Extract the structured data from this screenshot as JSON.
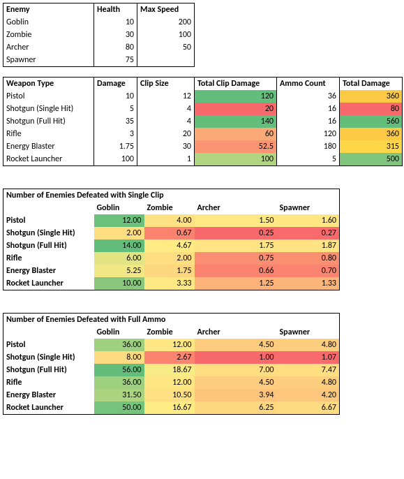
{
  "enemies": {
    "headers": [
      "Enemy",
      "Health",
      "Max Speed"
    ],
    "rows": [
      {
        "name": "Goblin",
        "health": "10",
        "speed": "200"
      },
      {
        "name": "Zombie",
        "health": "30",
        "speed": "100"
      },
      {
        "name": "Archer",
        "health": "80",
        "speed": "50"
      },
      {
        "name": "Spawner",
        "health": "75",
        "speed": ""
      }
    ]
  },
  "weapons": {
    "headers": [
      "Weapon Type",
      "Damage",
      "Clip Size",
      "Total Clip Damage",
      "Ammo Count",
      "Total Damage"
    ],
    "rows": [
      {
        "name": "Pistol",
        "dmg": "10",
        "clip": "12",
        "tcd": "120",
        "ac": "36",
        "td": "360",
        "tcd_c": "#63BE7B",
        "td_c": "#FCC944"
      },
      {
        "name": "Shotgun (Single Hit)",
        "dmg": "5",
        "clip": "4",
        "tcd": "20",
        "ac": "16",
        "td": "80",
        "tcd_c": "#F8696B",
        "td_c": "#F8696B"
      },
      {
        "name": "Shotgun (Full Hit)",
        "dmg": "35",
        "clip": "4",
        "tcd": "140",
        "ac": "16",
        "td": "560",
        "tcd_c": "#63BE7B",
        "td_c": "#63BE7B"
      },
      {
        "name": "Rifle",
        "dmg": "3",
        "clip": "20",
        "tcd": "60",
        "ac": "120",
        "td": "360",
        "tcd_c": "#FBAA77",
        "td_c": "#FCC944"
      },
      {
        "name": "Energy Blaster",
        "dmg": "1.75",
        "clip": "30",
        "tcd": "52.5",
        "ac": "180",
        "td": "315",
        "tcd_c": "#FA9473",
        "td_c": "#FDD747"
      },
      {
        "name": "Rocket Launcher",
        "dmg": "100",
        "clip": "1",
        "tcd": "100",
        "ac": "5",
        "td": "500",
        "tcd_c": "#B0D47F",
        "td_c": "#7FC57D"
      }
    ]
  },
  "clip_defeats": {
    "title": "Number of Enemies Defeated with Single Clip",
    "headers": [
      "",
      "Goblin",
      "Zombie",
      "Archer",
      "Spawner"
    ],
    "rows": [
      {
        "name": "Pistol",
        "v": [
          "12.00",
          "4.00",
          "1.50",
          "1.60"
        ],
        "c": [
          "#6BC07B",
          "#FEE182",
          "#FEE883",
          "#FEE683"
        ]
      },
      {
        "name": "Shotgun (Single Hit)",
        "v": [
          "2.00",
          "0.67",
          "0.25",
          "0.27"
        ],
        "c": [
          "#FEDE81",
          "#FA8370",
          "#F8696B",
          "#F86A6B"
        ]
      },
      {
        "name": "Shotgun (Full Hit)",
        "v": [
          "14.00",
          "4.67",
          "1.75",
          "1.87"
        ],
        "c": [
          "#63BE7B",
          "#FEEB84",
          "#FEE482",
          "#FEE382"
        ]
      },
      {
        "name": "Rifle",
        "v": [
          "6.00",
          "2.00",
          "0.75",
          "0.80"
        ],
        "c": [
          "#E2E383",
          "#FEDE81",
          "#FB8E72",
          "#FA8F72"
        ]
      },
      {
        "name": "Energy Blaster",
        "v": [
          "5.25",
          "1.75",
          "0.66",
          "0.70"
        ],
        "c": [
          "#F1E784",
          "#FDD780",
          "#FA8370",
          "#FA8470"
        ]
      },
      {
        "name": "Rocket Launcher",
        "v": [
          "10.00",
          "3.33",
          "1.25",
          "1.33"
        ],
        "c": [
          "#8AC77D",
          "#FEE883",
          "#FCB278",
          "#FCB579"
        ]
      }
    ]
  },
  "ammo_defeats": {
    "title": "Number of Enemies Defeated with Full Ammo",
    "headers": [
      "",
      "Goblin",
      "Zombie",
      "Archer",
      "Spawner"
    ],
    "rows": [
      {
        "name": "Pistol",
        "v": [
          "36.00",
          "12.00",
          "4.50",
          "4.80"
        ],
        "c": [
          "#9FD07F",
          "#FEE783",
          "#FDCC7E",
          "#FDCE7E"
        ]
      },
      {
        "name": "Shotgun (Single Hit)",
        "v": [
          "8.00",
          "2.67",
          "1.00",
          "1.07"
        ],
        "c": [
          "#FEDB81",
          "#FA8470",
          "#F8696B",
          "#F86A6B"
        ]
      },
      {
        "name": "Shotgun (Full Hit)",
        "v": [
          "56.00",
          "18.67",
          "7.00",
          "7.47"
        ],
        "c": [
          "#63BE7B",
          "#F8EA84",
          "#FEDD81",
          "#FEDE81"
        ]
      },
      {
        "name": "Rifle",
        "v": [
          "36.00",
          "12.00",
          "4.50",
          "4.80"
        ],
        "c": [
          "#9FD07F",
          "#FEE783",
          "#FDCC7E",
          "#FDCE7E"
        ]
      },
      {
        "name": "Energy Blaster",
        "v": [
          "31.50",
          "10.50",
          "3.94",
          "4.20"
        ],
        "c": [
          "#ACD480",
          "#FEE082",
          "#FDC57C",
          "#FDC77D"
        ]
      },
      {
        "name": "Rocket Launcher",
        "v": [
          "50.00",
          "16.67",
          "6.25",
          "6.67"
        ],
        "c": [
          "#75C37C",
          "#FDEB84",
          "#FED880",
          "#FEDA81"
        ]
      }
    ]
  },
  "chart_data": [
    {
      "type": "table",
      "title": "Enemy stats",
      "columns": [
        "Enemy",
        "Health",
        "Max Speed"
      ],
      "rows": [
        [
          "Goblin",
          10,
          200
        ],
        [
          "Zombie",
          30,
          100
        ],
        [
          "Archer",
          80,
          50
        ],
        [
          "Spawner",
          75,
          null
        ]
      ]
    },
    {
      "type": "table",
      "title": "Weapon stats",
      "columns": [
        "Weapon Type",
        "Damage",
        "Clip Size",
        "Total Clip Damage",
        "Ammo Count",
        "Total Damage"
      ],
      "rows": [
        [
          "Pistol",
          10,
          12,
          120,
          36,
          360
        ],
        [
          "Shotgun (Single Hit)",
          5,
          4,
          20,
          16,
          80
        ],
        [
          "Shotgun (Full Hit)",
          35,
          4,
          140,
          16,
          560
        ],
        [
          "Rifle",
          3,
          20,
          60,
          120,
          360
        ],
        [
          "Energy Blaster",
          1.75,
          30,
          52.5,
          180,
          315
        ],
        [
          "Rocket Launcher",
          100,
          1,
          100,
          5,
          500
        ]
      ]
    },
    {
      "type": "heatmap",
      "title": "Number of Enemies Defeated with Single Clip",
      "categories": [
        "Goblin",
        "Zombie",
        "Archer",
        "Spawner"
      ],
      "series": [
        {
          "name": "Pistol",
          "values": [
            12.0,
            4.0,
            1.5,
            1.6
          ]
        },
        {
          "name": "Shotgun (Single Hit)",
          "values": [
            2.0,
            0.67,
            0.25,
            0.27
          ]
        },
        {
          "name": "Shotgun (Full Hit)",
          "values": [
            14.0,
            4.67,
            1.75,
            1.87
          ]
        },
        {
          "name": "Rifle",
          "values": [
            6.0,
            2.0,
            0.75,
            0.8
          ]
        },
        {
          "name": "Energy Blaster",
          "values": [
            5.25,
            1.75,
            0.66,
            0.7
          ]
        },
        {
          "name": "Rocket Launcher",
          "values": [
            10.0,
            3.33,
            1.25,
            1.33
          ]
        }
      ]
    },
    {
      "type": "heatmap",
      "title": "Number of Enemies Defeated with Full Ammo",
      "categories": [
        "Goblin",
        "Zombie",
        "Archer",
        "Spawner"
      ],
      "series": [
        {
          "name": "Pistol",
          "values": [
            36.0,
            12.0,
            4.5,
            4.8
          ]
        },
        {
          "name": "Shotgun (Single Hit)",
          "values": [
            8.0,
            2.67,
            1.0,
            1.07
          ]
        },
        {
          "name": "Shotgun (Full Hit)",
          "values": [
            56.0,
            18.67,
            7.0,
            7.47
          ]
        },
        {
          "name": "Rifle",
          "values": [
            36.0,
            12.0,
            4.5,
            4.8
          ]
        },
        {
          "name": "Energy Blaster",
          "values": [
            31.5,
            10.5,
            3.94,
            4.2
          ]
        },
        {
          "name": "Rocket Launcher",
          "values": [
            50.0,
            16.67,
            6.25,
            6.67
          ]
        }
      ]
    }
  ]
}
